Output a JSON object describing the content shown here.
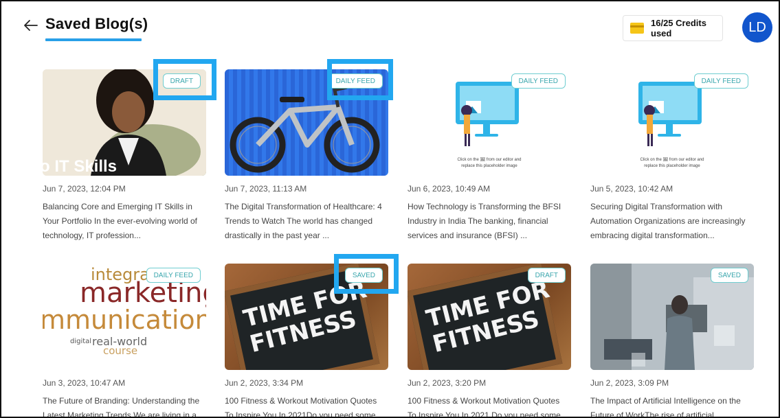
{
  "header": {
    "title": "Saved Blog(s)",
    "credits": "16/25 Credits used",
    "avatar_initials": "LD",
    "accent_color": "#28a0e8"
  },
  "blogs": [
    {
      "badge": "DRAFT",
      "date": "Jun 7, 2023, 12:04 PM",
      "snippet": "Balancing Core and Emerging IT Skills in Your Portfolio In the ever-evolving world of technology, IT profession...",
      "thumb_text": "o IT Skills"
    },
    {
      "badge": "DAILY FEED",
      "date": "Jun 7, 2023, 11:13 AM",
      "snippet": "The Digital Transformation of Healthcare: 4 Trends to Watch The world has changed drastically in the past year ..."
    },
    {
      "badge": "DAILY FEED",
      "date": "Jun 6, 2023, 10:49 AM",
      "snippet": "How Technology is Transforming the BFSI Industry in India The banking, financial services and insurance (BFSI) ...",
      "placeholder_line1": "Click on the 🖼 from our editor and",
      "placeholder_line2": "replace this placeholder image"
    },
    {
      "badge": "DAILY FEED",
      "date": "Jun 5, 2023, 10:42 AM",
      "snippet": "Securing Digital Transformation with Automation Organizations are increasingly embracing digital transformation...",
      "placeholder_line1": "Click on the 🖼 from our editor and",
      "placeholder_line2": "replace this placeholder image"
    },
    {
      "badge": "DAILY FEED",
      "date": "Jun 3, 2023, 10:47 AM",
      "snippet": "The Future of Branding: Understanding the Latest Marketing Trends We are living in a",
      "word1": "integrate",
      "word2": "marketing",
      "word3": "mmunication",
      "word4": "real-world",
      "word5": "course",
      "word6": "digital"
    },
    {
      "badge": "SAVED",
      "date": "Jun 2, 2023, 3:34 PM",
      "snippet": "  100 Fitness & Workout Motivation Quotes To Inspire You In 2021Do you need some",
      "line1": "TIME FOR",
      "line2": "FITNESS"
    },
    {
      "badge": "DRAFT",
      "date": "Jun 2, 2023, 3:20 PM",
      "snippet": "100 Fitness & Workout Motivation Quotes To Inspire You In 2021 Do you need some",
      "line1": "TIME FOR",
      "line2": "FITNESS"
    },
    {
      "badge": "SAVED",
      "date": "Jun 2, 2023, 3:09 PM",
      "snippet": " The Impact of Artificial Intelligence on the Future of WorkThe rise of artificial"
    }
  ]
}
